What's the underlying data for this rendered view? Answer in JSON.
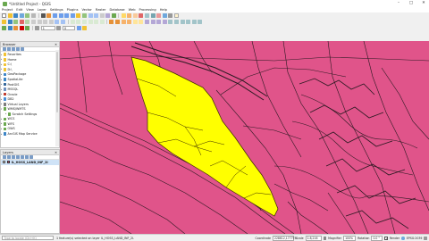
{
  "window": {
    "title": "*Untitled Project - QGIS",
    "controls": [
      "–",
      "□",
      "✕"
    ]
  },
  "menu": [
    "Project",
    "Edit",
    "View",
    "Layer",
    "Settings",
    "Plugins",
    "Vector",
    "Raster",
    "Database",
    "Web",
    "Processing",
    "Help"
  ],
  "toolbar": {
    "scale_field": "1",
    "zoom_field": "0"
  },
  "browser": {
    "title": "Browser",
    "items": [
      {
        "label": "Favorites",
        "icon_color": "#f1c232"
      },
      {
        "label": "Home",
        "icon_color": "#f1c232"
      },
      {
        "label": "C:\\",
        "icon_color": "#f1c232"
      },
      {
        "label": "D:\\",
        "icon_color": "#f1c232"
      },
      {
        "label": "GeoPackage",
        "icon_color": "#3d85c6"
      },
      {
        "label": "SpatiaLite",
        "icon_color": "#3d85c6"
      },
      {
        "label": "PostGIS",
        "icon_color": "#336699"
      },
      {
        "label": "MSSQL",
        "icon_color": "#6f8fbf"
      },
      {
        "label": "Oracle",
        "icon_color": "#c0392b"
      },
      {
        "label": "DB2",
        "icon_color": "#4a8fd6"
      },
      {
        "label": "Virtual Layers",
        "icon_color": "#7a7a7a"
      },
      {
        "label": "WMS/WMTS",
        "icon_color": "#6aa84f"
      },
      {
        "label": "Scratch Settings",
        "icon_color": "#6aa84f"
      },
      {
        "label": "WCS",
        "icon_color": "#6aa84f"
      },
      {
        "label": "WFS",
        "icon_color": "#6aa84f"
      },
      {
        "label": "OWS",
        "icon_color": "#6aa84f"
      },
      {
        "label": "ArcGIS Map Service",
        "icon_color": "#3d85c6"
      }
    ]
  },
  "layers": {
    "title": "Layers",
    "items": [
      {
        "label": "IL_HOSS_LAND_INF_2I",
        "checked": "✓",
        "symbol_color": "#e0548a"
      }
    ]
  },
  "statusbar": {
    "search_placeholder": "Type to locate (Ctrl+K)",
    "message": "1 feature(s) selected on layer IL_HOSS_LAND_INF_2I.",
    "coordinate_label": "Coordinate",
    "coordinate": "228612,177778",
    "scale_label": "Scale",
    "scale": "1:8,216",
    "magnifier_label": "Magnifier",
    "magnifier": "100%",
    "rotation_label": "Rotation",
    "rotation": "0.0 °",
    "render_label": "Render",
    "render_checked": "✓",
    "crs": "EPSG:2039"
  },
  "map": {
    "background_color": "#e0548a",
    "selection_color": "#ffff00",
    "line_color": "#2b1a22"
  }
}
